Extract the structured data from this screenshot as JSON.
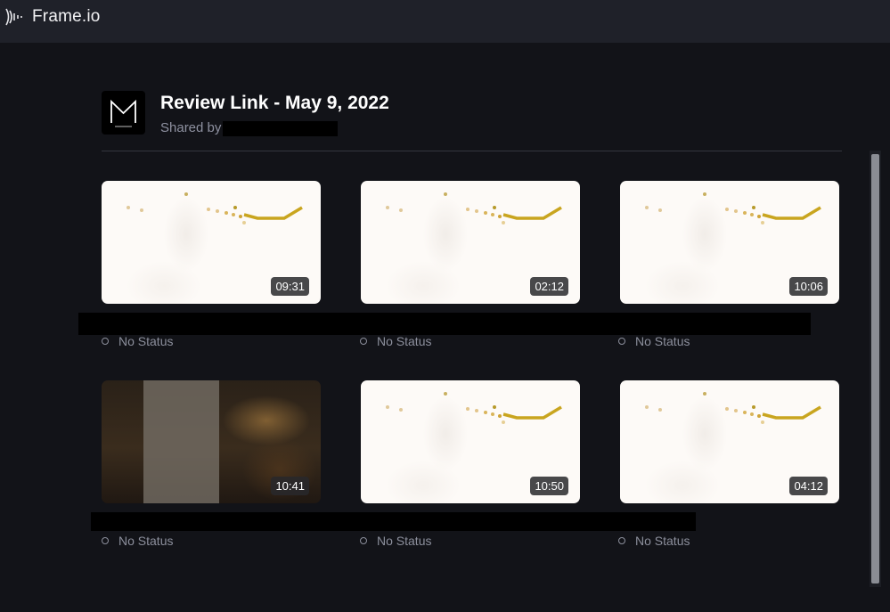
{
  "app": {
    "name": "Frame.io"
  },
  "header": {
    "title": "Review Link - May 9, 2022",
    "shared_by_label": "Shared by"
  },
  "assets": [
    {
      "duration": "09:31",
      "status": "No Status"
    },
    {
      "duration": "02:12",
      "status": "No Status"
    },
    {
      "duration": "10:06",
      "status": "No Status"
    },
    {
      "duration": "10:41",
      "status": "No Status"
    },
    {
      "duration": "10:50",
      "status": "No Status"
    },
    {
      "duration": "04:12",
      "status": "No Status"
    }
  ]
}
